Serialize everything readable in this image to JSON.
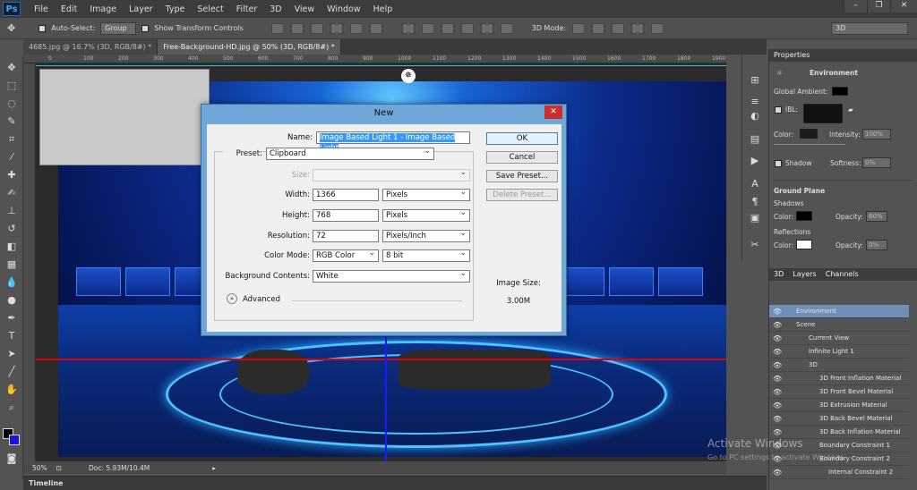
{
  "menubar": {
    "logo": "Ps",
    "items": [
      "File",
      "Edit",
      "Image",
      "Layer",
      "Type",
      "Select",
      "Filter",
      "3D",
      "View",
      "Window",
      "Help"
    ]
  },
  "options": {
    "auto_select": "Auto-Select:",
    "group": "Group",
    "show_transform": "Show Transform Controls",
    "mode_label": "3D Mode:",
    "workspace": "3D"
  },
  "tabs": [
    {
      "label": "4685.jpg @ 16.7% (3D, RGB/8#) *"
    },
    {
      "label": "Free-Background-HD.jpg @ 50% (3D, RGB/8#) *"
    }
  ],
  "ruler": [
    "0",
    "100",
    "200",
    "300",
    "400",
    "500",
    "600",
    "700",
    "800",
    "900",
    "1000",
    "1100",
    "1200",
    "1300",
    "1400",
    "1500",
    "1600",
    "1700",
    "1800",
    "1900"
  ],
  "status": {
    "zoom": "50%",
    "doc": "Doc: 5.93M/10.4M"
  },
  "timeline": "Timeline",
  "properties": {
    "tab": "Properties",
    "section": "Environment",
    "global_ambient": "Global Ambient:",
    "ibl": "IBL:",
    "color": "Color:",
    "intensity": "Intensity:",
    "intensity_val": "100%",
    "shadow": "Shadow",
    "softness": "Softness:",
    "softness_val": "0%",
    "ground_plane": "Ground Plane",
    "shadows": "Shadows",
    "opacity": "Opacity:",
    "shadows_opacity": "60%",
    "reflections": "Reflections",
    "refl_opacity": "0%"
  },
  "layers": {
    "tabs": [
      "3D",
      "Layers",
      "Channels"
    ],
    "rows": [
      "Environment",
      "Scene",
      "Current View",
      "Infinite Light 1",
      "3D",
      "3D Front Inflation Material",
      "3D Front Bevel Material",
      "3D Extrusion Material",
      "3D Back Bevel Material",
      "3D Back Inflation Material",
      "Boundary Constraint 1",
      "Boundary Constraint 2",
      "Internal Constraint 2"
    ]
  },
  "dialog": {
    "title": "New",
    "name_label": "Name:",
    "name_value": "Image Based Light 1 - Image Based Light",
    "preset_label": "Preset:",
    "preset_value": "Clipboard",
    "size_label": "Size:",
    "width_label": "Width:",
    "width_value": "1366",
    "width_unit": "Pixels",
    "height_label": "Height:",
    "height_value": "768",
    "height_unit": "Pixels",
    "res_label": "Resolution:",
    "res_value": "72",
    "res_unit": "Pixels/Inch",
    "mode_label": "Color Mode:",
    "mode_value": "RGB Color",
    "mode_bits": "8 bit",
    "bg_label": "Background Contents:",
    "bg_value": "White",
    "advanced": "Advanced",
    "ok": "OK",
    "cancel": "Cancel",
    "save_preset": "Save Preset...",
    "delete_preset": "Delete Preset...",
    "image_size_label": "Image Size:",
    "image_size_value": "3.00M"
  },
  "watermark": {
    "title": "Activate Windows",
    "sub": "Go to PC settings to activate Windows."
  }
}
